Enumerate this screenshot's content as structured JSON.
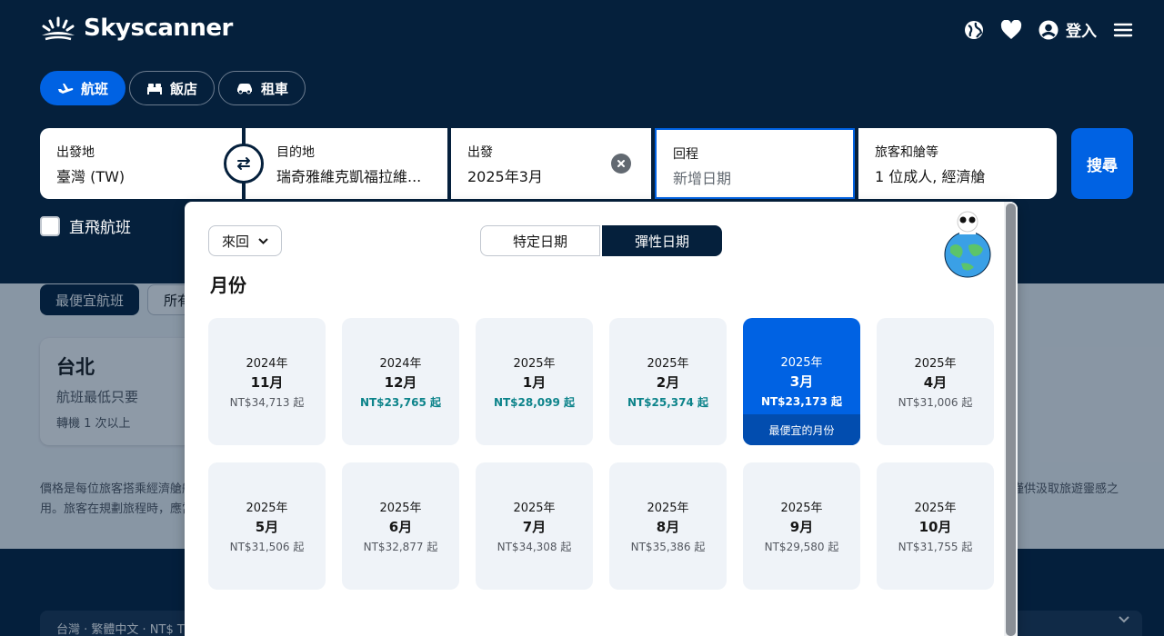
{
  "brand": {
    "name": "Skyscanner"
  },
  "topnav": {
    "login_label": "登入"
  },
  "tabs": [
    {
      "label": "航班",
      "icon": "plane-icon",
      "active": true
    },
    {
      "label": "飯店",
      "icon": "bed-icon",
      "active": false
    },
    {
      "label": "租車",
      "icon": "car-icon",
      "active": false
    }
  ],
  "search": {
    "origin": {
      "label": "出發地",
      "value": "臺灣 (TW)"
    },
    "destination": {
      "label": "目的地",
      "value": "瑞奇雅維克凱福拉維..."
    },
    "depart": {
      "label": "出發",
      "value": "2025年3月"
    },
    "return": {
      "label": "回程",
      "placeholder": "新增日期"
    },
    "travellers": {
      "label": "旅客和艙等",
      "value": "1 位成人, 經濟艙"
    },
    "button_label": "搜尋"
  },
  "direct_flights_label": "直飛航班",
  "background": {
    "chip_cheapest": "最便宜航班",
    "chip_all": "所有",
    "card": {
      "city": "台北",
      "line1": "航班最低只要",
      "line2": "轉機 1 次以上"
    },
    "disclaimer_left": "價格是每位旅客搭乘經濟艙航",
    "disclaimer_left2": "用。旅客在規劃旅程時，應當",
    "disclaimer_right": "僅供汲取旅遊靈感之",
    "footer_locale": "台灣 · 繁體中文 · NT$ TW"
  },
  "picker": {
    "trip_type": "來回",
    "mode_specific": "特定日期",
    "mode_flexible": "彈性日期",
    "section_title": "月份",
    "selected_badge": "最便宜的月份",
    "months": [
      {
        "year": "2024年",
        "month": "11月",
        "price": "NT$34,713 起",
        "cheap": false,
        "selected": false
      },
      {
        "year": "2024年",
        "month": "12月",
        "price": "NT$23,765 起",
        "cheap": true,
        "selected": false
      },
      {
        "year": "2025年",
        "month": "1月",
        "price": "NT$28,099 起",
        "cheap": true,
        "selected": false
      },
      {
        "year": "2025年",
        "month": "2月",
        "price": "NT$25,374 起",
        "cheap": true,
        "selected": false
      },
      {
        "year": "2025年",
        "month": "3月",
        "price": "NT$23,173 起",
        "cheap": false,
        "selected": true
      },
      {
        "year": "2025年",
        "month": "4月",
        "price": "NT$31,006 起",
        "cheap": false,
        "selected": false
      },
      {
        "year": "2025年",
        "month": "5月",
        "price": "NT$31,506 起",
        "cheap": false,
        "selected": false
      },
      {
        "year": "2025年",
        "month": "6月",
        "price": "NT$32,877 起",
        "cheap": false,
        "selected": false
      },
      {
        "year": "2025年",
        "month": "7月",
        "price": "NT$34,308 起",
        "cheap": false,
        "selected": false
      },
      {
        "year": "2025年",
        "month": "8月",
        "price": "NT$35,386 起",
        "cheap": false,
        "selected": false
      },
      {
        "year": "2025年",
        "month": "9月",
        "price": "NT$29,580 起",
        "cheap": false,
        "selected": false
      },
      {
        "year": "2025年",
        "month": "10月",
        "price": "NT$31,755 起",
        "cheap": false,
        "selected": false
      }
    ]
  },
  "colors": {
    "navy": "#05203c",
    "primary": "#0062e3",
    "cheap_price": "#0c838a"
  }
}
